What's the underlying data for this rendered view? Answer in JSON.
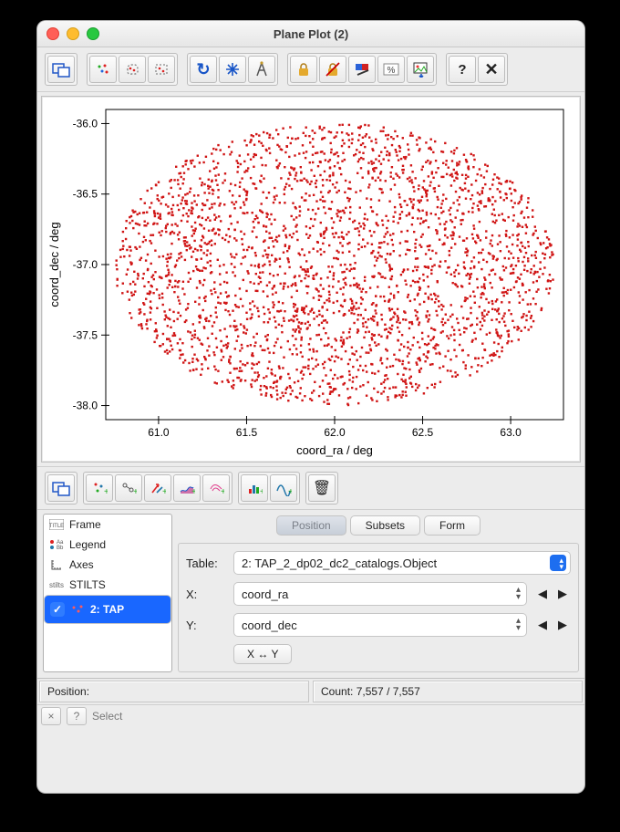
{
  "window": {
    "title": "Plane Plot (2)"
  },
  "toolbar_top": {
    "panel_toggle": "panel-toggle",
    "subset_from_visible": "draw-subset-icon",
    "blob_subset": "blob-subset-icon",
    "rect_subset": "rect-subset-icon",
    "replot": "↻",
    "resize": "✥",
    "measure": "Å",
    "lock_x": "🔒",
    "lock_y": "🔓",
    "sketch": "paint-icon",
    "percent": "%",
    "export": "export-icon",
    "help": "?",
    "close": "✕"
  },
  "chart_data": {
    "type": "scatter",
    "title": "",
    "xlabel": "coord_ra / deg",
    "ylabel": "coord_dec / deg",
    "xlim": [
      60.7,
      63.3
    ],
    "ylim": [
      -38.1,
      -35.9
    ],
    "xticks": [
      61.0,
      61.5,
      62.0,
      62.5,
      63.0
    ],
    "yticks": [
      -36.0,
      -36.5,
      -37.0,
      -37.5,
      -38.0
    ],
    "n_points": 7557,
    "point_color": "#d01515",
    "distribution": "Uniformly scattered within an ellipse centered at (ra≈62.0, dec≈-37.0) with semi-axes ≈1.25 deg (RA) and ≈1.0 deg (Dec)"
  },
  "mid_toolbar": {
    "add_panel": "panel-add",
    "add_mark": "mark-layer",
    "add_pair": "pair-layer",
    "add_vector": "vector-layer",
    "add_fill": "area-layer",
    "add_contour": "contour-layer",
    "add_hist": "histogram-layer",
    "add_func": "function-layer",
    "delete": "🗑"
  },
  "tree": {
    "items": [
      {
        "id": "frame",
        "label": "Frame"
      },
      {
        "id": "legend",
        "label": "Legend"
      },
      {
        "id": "axes",
        "label": "Axes"
      },
      {
        "id": "stilts",
        "label": "STILTS"
      },
      {
        "id": "layer1",
        "label": "2: TAP",
        "selected": true,
        "checked": true
      }
    ]
  },
  "tabs": {
    "position": "Position",
    "subsets": "Subsets",
    "form": "Form",
    "active": "position"
  },
  "form_fields": {
    "table_label": "Table:",
    "table_value": "2: TAP_2_dp02_dc2_catalogs.Object",
    "x_label": "X:",
    "x_value": "coord_ra",
    "y_label": "Y:",
    "y_value": "coord_dec",
    "swap": "X ↔ Y"
  },
  "status": {
    "position_label": "Position:",
    "position_value": "",
    "count_label": "Count:",
    "count_value": "7,557 / 7,557"
  },
  "helpbar": {
    "close": "×",
    "help": "?",
    "select": "Select"
  }
}
